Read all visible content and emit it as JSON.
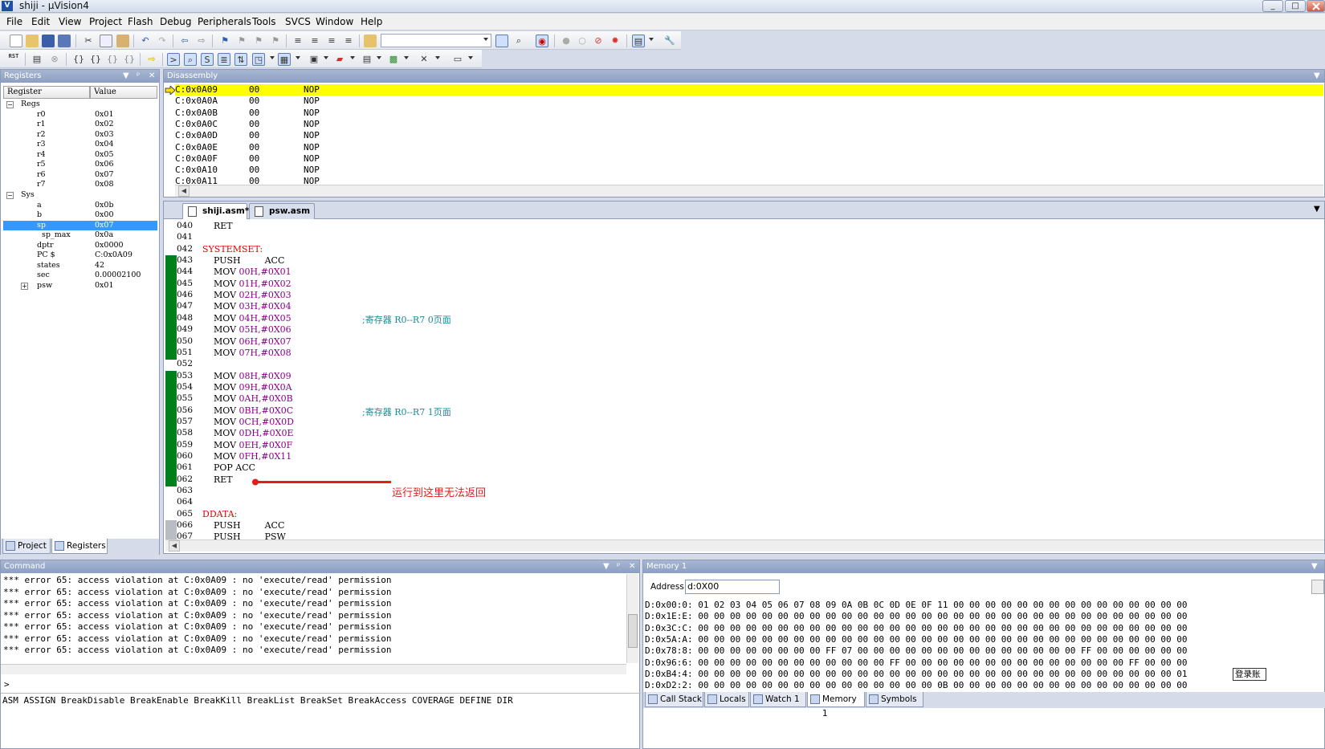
{
  "window": {
    "app_logo": "V",
    "title": "shiji - µVision4",
    "btn_min": "_",
    "btn_max": "□"
  },
  "menu": [
    "File",
    "Edit",
    "View",
    "Project",
    "Flash",
    "Debug",
    "Peripherals",
    "Tools",
    "SVCS",
    "Window",
    "Help"
  ],
  "toolbar": {
    "rst_label": "RST"
  },
  "registers": {
    "pane_title": "Registers",
    "col_register": "Register",
    "col_value": "Value",
    "rows": [
      {
        "name": "Regs",
        "value": "",
        "indent": 0,
        "box": "−"
      },
      {
        "name": "r0",
        "value": "0x01",
        "indent": 2
      },
      {
        "name": "r1",
        "value": "0x02",
        "indent": 2
      },
      {
        "name": "r2",
        "value": "0x03",
        "indent": 2
      },
      {
        "name": "r3",
        "value": "0x04",
        "indent": 2
      },
      {
        "name": "r4",
        "value": "0x05",
        "indent": 2
      },
      {
        "name": "r5",
        "value": "0x06",
        "indent": 2
      },
      {
        "name": "r6",
        "value": "0x07",
        "indent": 2
      },
      {
        "name": "r7",
        "value": "0x08",
        "indent": 2
      },
      {
        "name": "Sys",
        "value": "",
        "indent": 0,
        "box": "−"
      },
      {
        "name": "a",
        "value": "0x0b",
        "indent": 2
      },
      {
        "name": "b",
        "value": "0x00",
        "indent": 2
      },
      {
        "name": "sp",
        "value": "0x07",
        "indent": 2,
        "selected": true
      },
      {
        "name": "sp_max",
        "value": "0x0a",
        "indent": 3
      },
      {
        "name": "dptr",
        "value": "0x0000",
        "indent": 2
      },
      {
        "name": "PC  $",
        "value": "C:0x0A09",
        "indent": 2
      },
      {
        "name": "states",
        "value": "42",
        "indent": 2
      },
      {
        "name": "sec",
        "value": "0.00002100",
        "indent": 2
      },
      {
        "name": "psw",
        "value": "0x01",
        "indent": 2,
        "box": "+"
      }
    ],
    "tab_project": "Project",
    "tab_registers": "Registers"
  },
  "disassembly": {
    "pane_title": "Disassembly",
    "rows": [
      {
        "addr": "C:0x0A09",
        "code": "00",
        "instr": "NOP",
        "current": true
      },
      {
        "addr": "C:0x0A0A",
        "code": "00",
        "instr": "NOP"
      },
      {
        "addr": "C:0x0A0B",
        "code": "00",
        "instr": "NOP"
      },
      {
        "addr": "C:0x0A0C",
        "code": "00",
        "instr": "NOP"
      },
      {
        "addr": "C:0x0A0D",
        "code": "00",
        "instr": "NOP"
      },
      {
        "addr": "C:0x0A0E",
        "code": "00",
        "instr": "NOP"
      },
      {
        "addr": "C:0x0A0F",
        "code": "00",
        "instr": "NOP"
      },
      {
        "addr": "C:0x0A10",
        "code": "00",
        "instr": "NOP"
      },
      {
        "addr": "C:0x0A11",
        "code": "00",
        "instr": "NOP"
      }
    ]
  },
  "editor": {
    "tabs": [
      {
        "label": "shiji.asm*",
        "active": true
      },
      {
        "label": "psw.asm",
        "active": false
      }
    ],
    "lines": [
      {
        "n": "040",
        "code": "    RET",
        "mark": "none"
      },
      {
        "n": "041",
        "code": "",
        "mark": "none"
      },
      {
        "n": "042",
        "label": "SYSTEMSET:",
        "mark": "none"
      },
      {
        "n": "043",
        "code": "    PUSH",
        "operand": "ACC",
        "opcol": "kw",
        "mark": "green"
      },
      {
        "n": "044",
        "code": "    MOV ",
        "operand": "00H,#0X01",
        "mark": "green"
      },
      {
        "n": "045",
        "code": "    MOV ",
        "operand": "01H,#0X02",
        "mark": "green"
      },
      {
        "n": "046",
        "code": "    MOV ",
        "operand": "02H,#0X03",
        "mark": "green"
      },
      {
        "n": "047",
        "code": "    MOV ",
        "operand": "03H,#0X04",
        "mark": "green"
      },
      {
        "n": "048",
        "code": "    MOV ",
        "operand": "04H,#0X05",
        "comment": ";寄存器 R0--R7 0页面",
        "mark": "green"
      },
      {
        "n": "049",
        "code": "    MOV ",
        "operand": "05H,#0X06",
        "mark": "green"
      },
      {
        "n": "050",
        "code": "    MOV ",
        "operand": "06H,#0X07",
        "mark": "green"
      },
      {
        "n": "051",
        "code": "    MOV ",
        "operand": "07H,#0X08",
        "mark": "green"
      },
      {
        "n": "052",
        "code": "",
        "mark": "none"
      },
      {
        "n": "053",
        "code": "    MOV ",
        "operand": "08H,#0X09",
        "mark": "green"
      },
      {
        "n": "054",
        "code": "    MOV ",
        "operand": "09H,#0X0A",
        "mark": "green"
      },
      {
        "n": "055",
        "code": "    MOV ",
        "operand": "0AH,#0X0B",
        "mark": "green"
      },
      {
        "n": "056",
        "code": "    MOV ",
        "operand": "0BH,#0X0C",
        "comment": ";寄存器 R0--R7 1页面",
        "mark": "green"
      },
      {
        "n": "057",
        "code": "    MOV ",
        "operand": "0CH,#0X0D",
        "mark": "green"
      },
      {
        "n": "058",
        "code": "    MOV ",
        "operand": "0DH,#0X0E",
        "mark": "green"
      },
      {
        "n": "059",
        "code": "    MOV ",
        "operand": "0EH,#0X0F",
        "mark": "green"
      },
      {
        "n": "060",
        "code": "    MOV ",
        "operand": "0FH,#0X11",
        "mark": "green"
      },
      {
        "n": "061",
        "code": "    POP ACC",
        "mark": "green"
      },
      {
        "n": "062",
        "code": "    RET",
        "mark": "green"
      },
      {
        "n": "063",
        "code": "",
        "mark": "none"
      },
      {
        "n": "064",
        "code": "",
        "mark": "none"
      },
      {
        "n": "065",
        "label": "DDATA:",
        "mark": "none"
      },
      {
        "n": "066",
        "code": "    PUSH",
        "operand": "ACC",
        "opcol": "kw",
        "mark": "gray"
      },
      {
        "n": "067",
        "code": "    PUSH",
        "operand": "PSW",
        "opcol": "kw",
        "mark": "gray"
      }
    ],
    "annotation": "运行到这里无法返回",
    "annotation_color": "#e51c1c"
  },
  "command": {
    "pane_title": "Command",
    "lines": [
      "*** error 65: access violation at C:0x0A09 : no 'execute/read' permission",
      "*** error 65: access violation at C:0x0A09 : no 'execute/read' permission",
      "*** error 65: access violation at C:0x0A09 : no 'execute/read' permission",
      "*** error 65: access violation at C:0x0A09 : no 'execute/read' permission",
      "*** error 65: access violation at C:0x0A09 : no 'execute/read' permission",
      "*** error 65: access violation at C:0x0A09 : no 'execute/read' permission",
      "*** error 65: access violation at C:0x0A09 : no 'execute/read' permission"
    ],
    "prompt": ">",
    "hints": "ASM ASSIGN BreakDisable BreakEnable BreakKill BreakList BreakSet BreakAccess COVERAGE DEFINE DIR"
  },
  "memory": {
    "pane_title": "Memory 1",
    "address_label": "Address:",
    "address_value": "d:0X00",
    "lines": [
      "D:0x00:0: 01 02 03 04 05 06 07 08 09 0A 0B 0C 0D 0E 0F 11 00 00 00 00 00 00 00 00 00 00 00 00 00 00 00",
      "D:0x1E:E: 00 00 00 00 00 00 00 00 00 00 00 00 00 00 00 00 00 00 00 00 00 00 00 00 00 00 00 00 00 00 00",
      "D:0x3C:C: 00 00 00 00 00 00 00 00 00 00 00 00 00 00 00 00 00 00 00 00 00 00 00 00 00 00 00 00 00 00 00",
      "D:0x5A:A: 00 00 00 00 00 00 00 00 00 00 00 00 00 00 00 00 00 00 00 00 00 00 00 00 00 00 00 00 00 00 00",
      "D:0x78:8: 00 00 00 00 00 00 00 00 FF 07 00 00 00 00 00 00 00 00 00 00 00 00 00 00 FF 00 00 00 00 00 00",
      "D:0x96:6: 00 00 00 00 00 00 00 00 00 00 00 00 FF 00 00 00 00 00 00 00 00 00 00 00 00 00 00 FF 00 00 00",
      "D:0xB4:4: 00 00 00 00 00 00 00 00 00 00 00 00 00 00 00 00 00 00 00 00 00 00 00 00 00 00 00 00 00 00 01",
      "D:0xD2:2: 00 00 00 00 00 00 00 00 00 00 00 00 00 00 00 0B 00 00 00 00 00 00 00 00 00 00 00 00 00 00 00"
    ],
    "tooltip": "登录账",
    "tabs": [
      "Call Stack",
      "Locals",
      "Watch 1",
      "Memory 1",
      "Symbols"
    ]
  }
}
